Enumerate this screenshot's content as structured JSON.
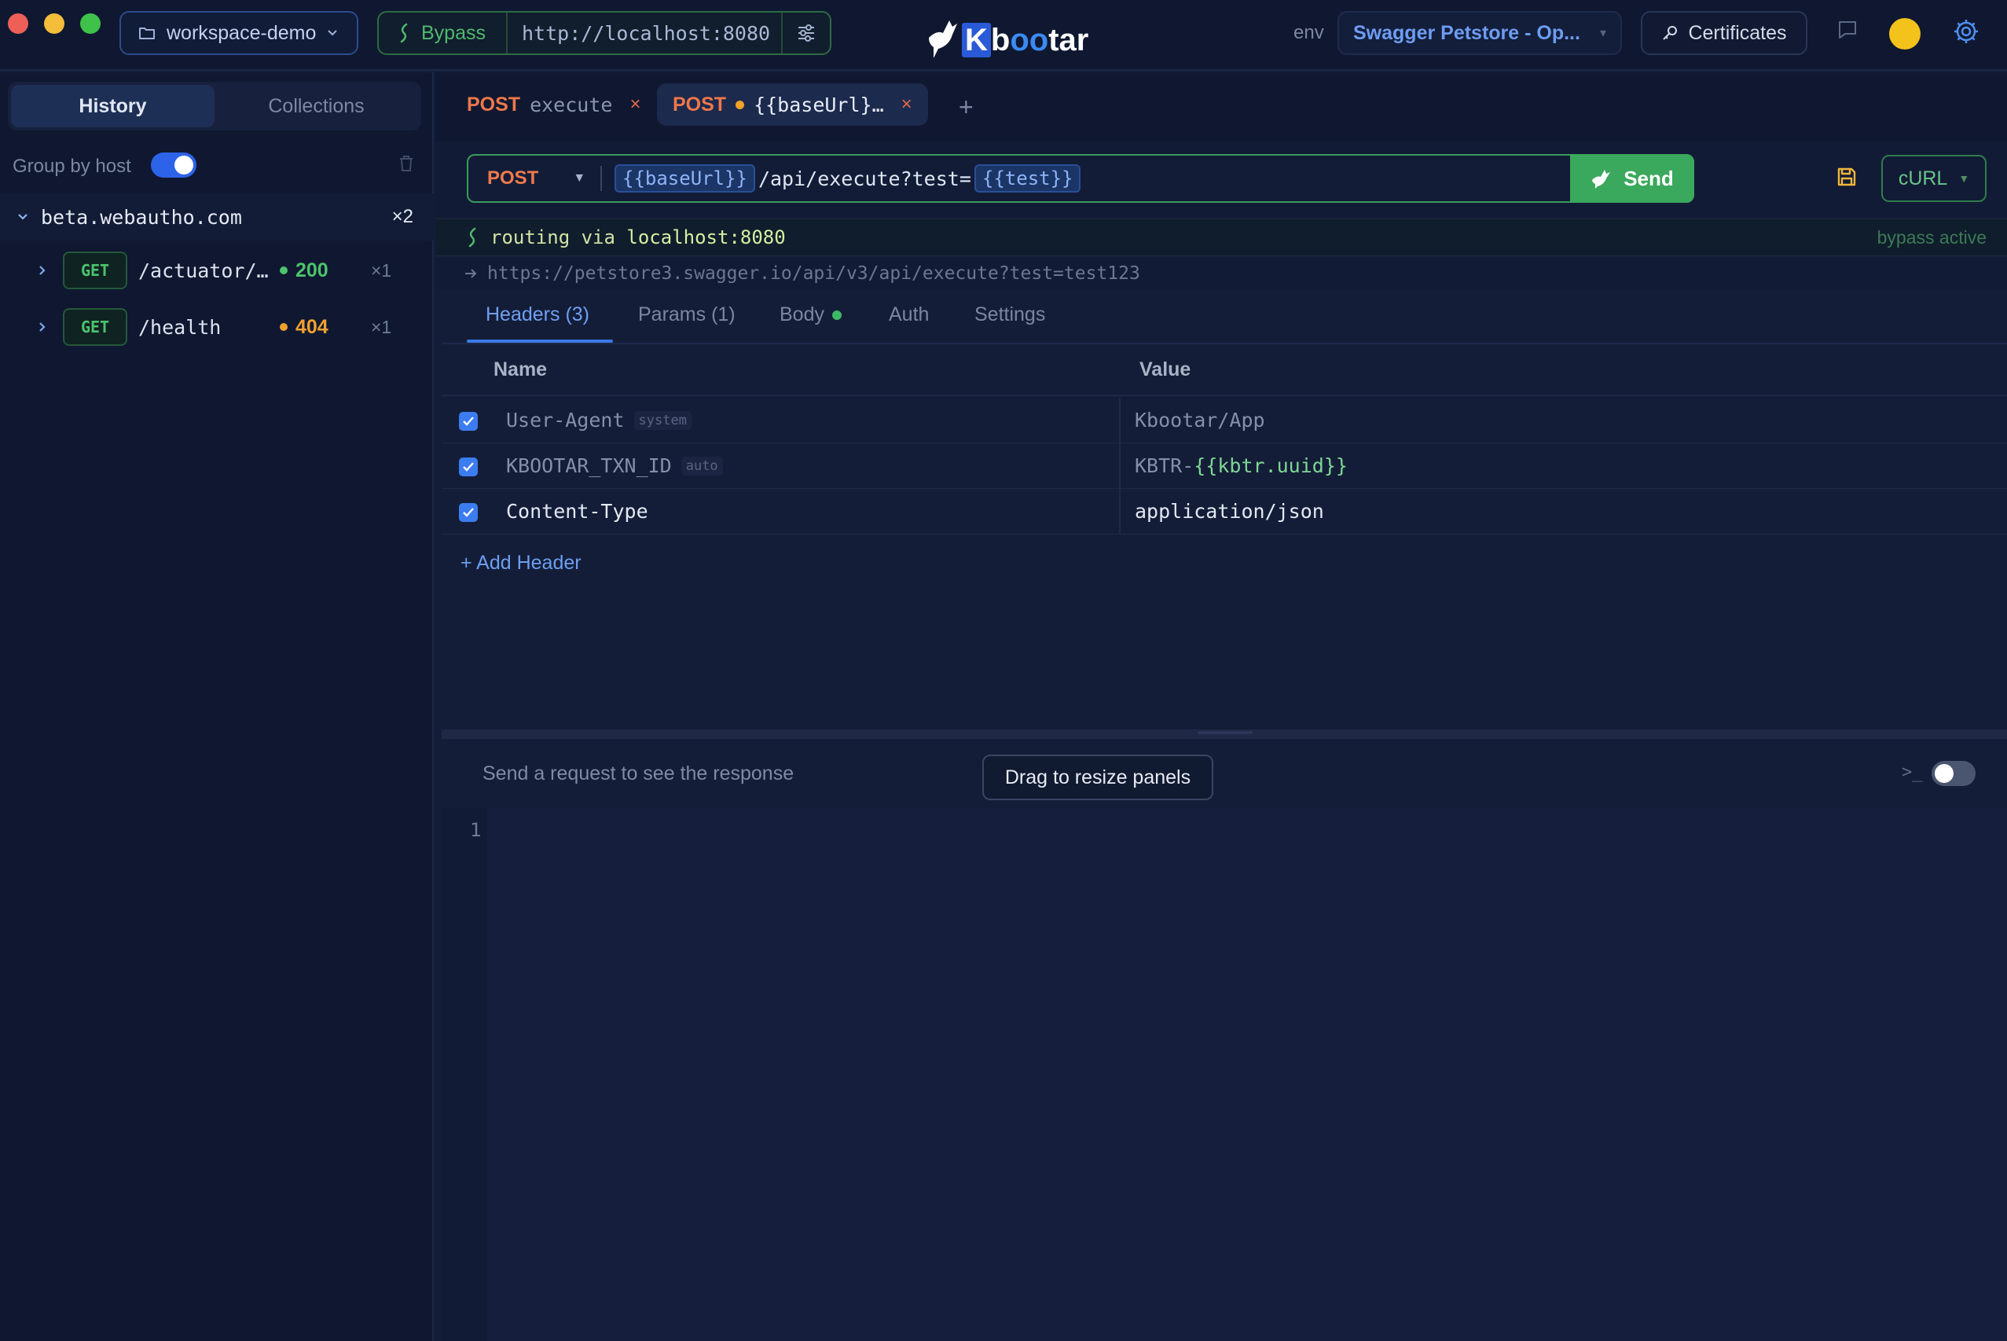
{
  "window": {
    "workspace": "workspace-demo",
    "bypass_label": "Bypass",
    "bypass_url": "http://localhost:8080",
    "app_name": "Kbootar",
    "env_label": "env",
    "env_value": "Swagger Petstore - Op...",
    "certificates_label": "Certificates"
  },
  "sidebar": {
    "tabs": [
      {
        "label": "History",
        "active": true
      },
      {
        "label": "Collections",
        "active": false
      }
    ],
    "group_by_host_label": "Group by host",
    "group_by_host_on": true,
    "host": {
      "name": "beta.webautho.com",
      "count": "×2"
    },
    "items": [
      {
        "method": "GET",
        "path": "/actuator/…",
        "status": "200",
        "status_color": "#4cc36d",
        "count": "×1"
      },
      {
        "method": "GET",
        "path": "/health",
        "status": "404",
        "status_color": "#f0a030",
        "count": "×1"
      }
    ]
  },
  "request_tabs": [
    {
      "method": "POST",
      "name": "execute",
      "active": false,
      "unsaved": false
    },
    {
      "method": "POST",
      "name": "{{baseUrl}…",
      "active": true,
      "unsaved": true
    }
  ],
  "request": {
    "method": "POST",
    "url_var1": "{{baseUrl}}",
    "url_mid": "/api/execute?test=",
    "url_var2": "{{test}}",
    "send_label": "Send",
    "export_label": "cURL"
  },
  "routing": {
    "prefix": "routing via",
    "host": "localhost:8080",
    "status": "bypass active"
  },
  "resolved_url": "https://petstore3.swagger.io/api/v3/api/execute?test=test123",
  "subtabs": [
    {
      "label": "Headers (3)",
      "active": true
    },
    {
      "label": "Params (1)",
      "active": false
    },
    {
      "label": "Body",
      "active": false,
      "dot": true
    },
    {
      "label": "Auth",
      "active": false
    },
    {
      "label": "Settings",
      "active": false
    }
  ],
  "headers_table": {
    "col_name": "Name",
    "col_value": "Value",
    "rows": [
      {
        "name": "User-Agent",
        "tag": "system",
        "value": "Kbootar/App",
        "checked": true
      },
      {
        "name": "KBOOTAR_TXN_ID",
        "tag": "auto",
        "value_prefix": "KBTR-",
        "value_var": "{{kbtr.uuid}}",
        "checked": true
      },
      {
        "name": "Content-Type",
        "value": "application/json",
        "checked": true
      }
    ],
    "add_label": "+ Add Header"
  },
  "response": {
    "placeholder": "Send a request to see the response",
    "tooltip": "Drag to resize panels",
    "line_number": "1"
  },
  "colors": {
    "accent_blue": "#3b7cf0",
    "send_green": "#3aa85d",
    "method_post": "#f0774a",
    "method_get": "#4cc36d"
  }
}
